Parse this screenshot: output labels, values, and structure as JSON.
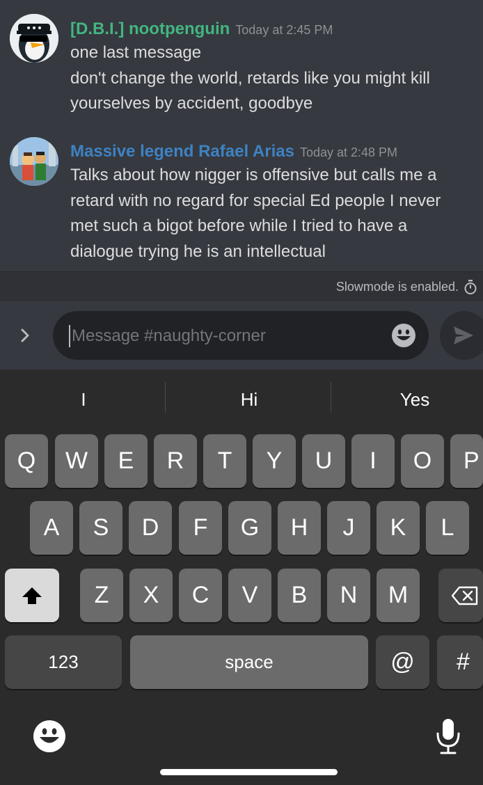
{
  "messages": [
    {
      "author": "[D.B.I.] nootpenguin",
      "author_color": "#43b581",
      "timestamp": "Today at 2:45 PM",
      "lines": [
        "one last message",
        "don't change the world, retards like you might kill",
        "yourselves by accident, goodbye"
      ],
      "avatar_icon": "penguin-with-sunglasses-avatar"
    },
    {
      "author": "Massive legend Rafael Arias",
      "author_color": "#3e82c3",
      "timestamp": "Today at 2:48 PM",
      "lines": [
        "Talks about how nigger is offensive but calls me a",
        "retard with no regard for special Ed people I never",
        "met such a bigot before while I tried to have a",
        "dialogue trying he is an intellectual"
      ],
      "avatar_icon": "cartoon-scene-avatar"
    }
  ],
  "slowmode": {
    "text": "Slowmode is enabled.",
    "icon": "stopwatch-icon"
  },
  "composer": {
    "placeholder": "Message #naughty-corner",
    "expand_icon": "chevron-right-icon",
    "emoji_icon": "smiley-icon",
    "send_icon": "send-icon"
  },
  "keyboard": {
    "suggestions": [
      "I",
      "Hi",
      "Yes"
    ],
    "row1": [
      "Q",
      "W",
      "E",
      "R",
      "T",
      "Y",
      "U",
      "I",
      "O",
      "P"
    ],
    "row2": [
      "A",
      "S",
      "D",
      "F",
      "G",
      "H",
      "J",
      "K",
      "L"
    ],
    "row3": [
      "Z",
      "X",
      "C",
      "V",
      "B",
      "N",
      "M"
    ],
    "numbers_label": "123",
    "space_label": "space",
    "at_label": "@",
    "hash_label": "#",
    "shift_icon": "shift-arrow-icon",
    "backspace_icon": "backspace-icon",
    "emoji_icon": "emoji-keyboard-icon",
    "mic_icon": "microphone-icon"
  },
  "colors": {
    "background": "#36393f",
    "input_bg": "#202225",
    "keyboard_bg": "#2b2b2b",
    "key": "#6b6b6b"
  }
}
